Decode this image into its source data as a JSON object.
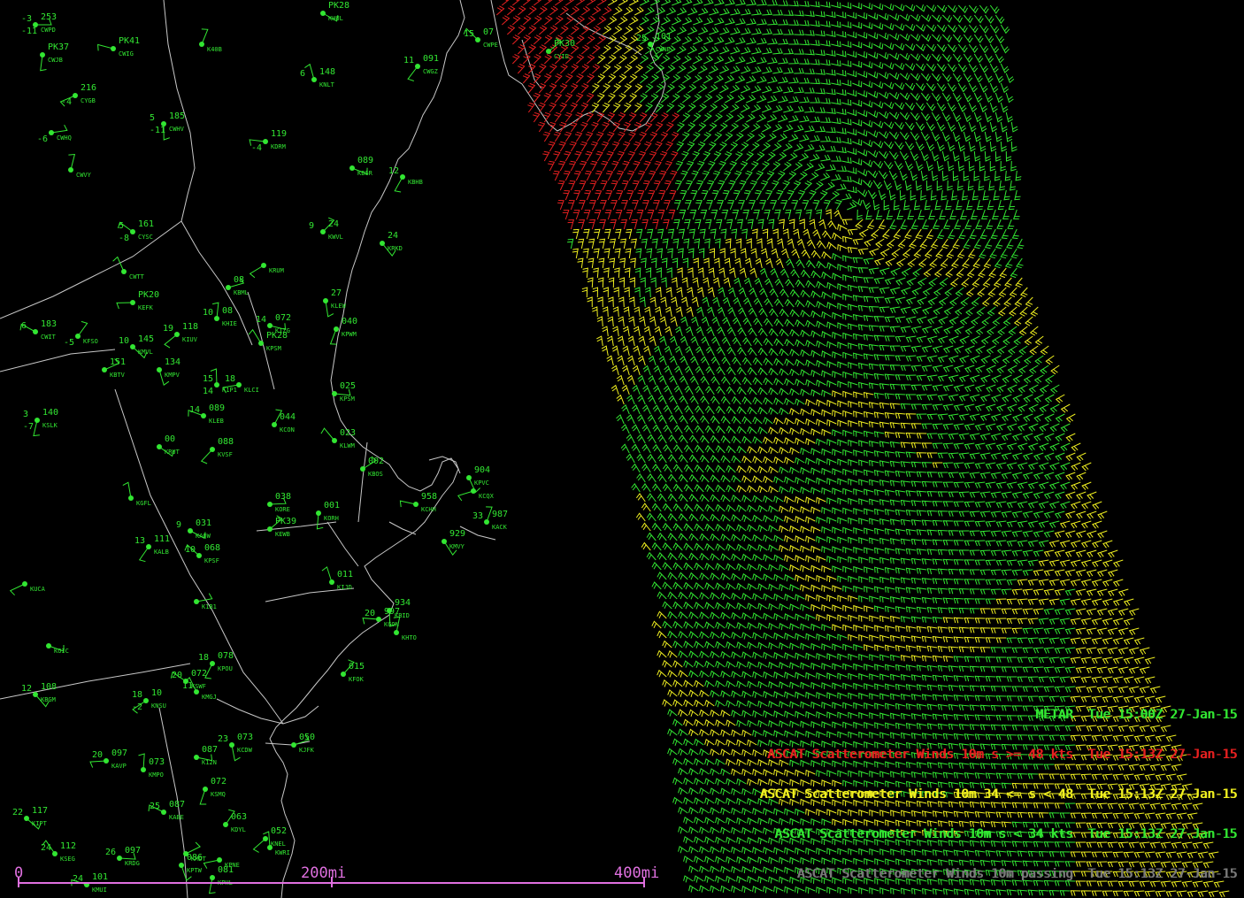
{
  "legend": [
    {
      "text": "METAR  Tue 15:00Z 27-Jan-15",
      "color": "#32e632"
    },
    {
      "text": "ASCAT Scatterometer Winds 10m s >= 48 kts  Tue 15:13Z 27-Jan-15",
      "color": "#e62020"
    },
    {
      "text": "ASCAT Scatterometer Winds 10m 34 <= s < 48  Tue 15:13Z 27-Jan-15",
      "color": "#f0f020"
    },
    {
      "text": "ASCAT Scatterometer Winds 10m s < 34 kts  Tue 15:13Z 27-Jan-15",
      "color": "#32e632"
    },
    {
      "text": "ASCAT Scatterometer Winds 10m passing  Tue 15:13Z 27-Jan-15",
      "color": "#7a7a7a"
    }
  ],
  "scale": {
    "labels": [
      "0",
      "200mi",
      "400mi"
    ],
    "color": "#e070e0"
  },
  "colors": {
    "land_outline": "#c8c8c8",
    "metar": "#32e632",
    "station_marker": "#ffffff",
    "wind_strong": "#e62020",
    "wind_moderate": "#f0f020",
    "wind_light": "#32e632"
  },
  "stations": [
    {
      "id": "CWPD",
      "temp": "-3",
      "dew": "-11",
      "pres": "253"
    },
    {
      "id": "CWJB",
      "temp": "",
      "dew": "",
      "pres": "PK37"
    },
    {
      "id": "CWIG",
      "temp": "",
      "dew": "",
      "pres": "PK41"
    },
    {
      "id": "K40B",
      "temp": "",
      "dew": "",
      "pres": ""
    },
    {
      "id": "KHUL",
      "temp": "",
      "dew": "",
      "pres": "PK28"
    },
    {
      "id": "CWGZ",
      "temp": "11",
      "dew": "",
      "pres": "091"
    },
    {
      "id": "CWPE",
      "temp": "15",
      "dew": "",
      "pres": "07"
    },
    {
      "id": "CYID",
      "temp": "",
      "dew": "",
      "pres": "PK30"
    },
    {
      "id": "CWNE",
      "temp": "25",
      "dew": "",
      "pres": "101"
    },
    {
      "id": "CYGB",
      "temp": "",
      "dew": "-4",
      "pres": "216"
    },
    {
      "id": "KNLT",
      "temp": "6",
      "dew": "",
      "pres": "148"
    },
    {
      "id": "CWHQ",
      "temp": "",
      "dew": "-6",
      "pres": ""
    },
    {
      "id": "CWHV",
      "temp": "5",
      "dew": "-11",
      "pres": "185"
    },
    {
      "id": "KDRM",
      "temp": "",
      "dew": "-4",
      "pres": "119"
    },
    {
      "id": "CWVY",
      "temp": "",
      "dew": "",
      "pres": ""
    },
    {
      "id": "KBGR",
      "temp": "",
      "dew": "",
      "pres": "089"
    },
    {
      "id": "KBHB",
      "temp": "12",
      "dew": "",
      "pres": ""
    },
    {
      "id": "CYSC",
      "temp": "5",
      "dew": "-8",
      "pres": "161"
    },
    {
      "id": "KWVL",
      "temp": "9",
      "dew": "",
      "pres": "24"
    },
    {
      "id": "KRKD",
      "temp": "",
      "dew": "",
      "pres": "24"
    },
    {
      "id": "KRUM",
      "temp": "",
      "dew": "",
      "pres": ""
    },
    {
      "id": "CWTT",
      "temp": "",
      "dew": "",
      "pres": ""
    },
    {
      "id": "KBML",
      "temp": "",
      "dew": "",
      "pres": "08"
    },
    {
      "id": "KLEW",
      "temp": "",
      "dew": "",
      "pres": "27"
    },
    {
      "id": "KEFK",
      "temp": "",
      "dew": "",
      "pres": "PK20"
    },
    {
      "id": "KHIE",
      "temp": "10",
      "dew": "",
      "pres": "08"
    },
    {
      "id": "KIZG",
      "temp": "14",
      "dew": "",
      "pres": "072"
    },
    {
      "id": "KPWM",
      "temp": "",
      "dew": "",
      "pres": "040"
    },
    {
      "id": "CWIT",
      "temp": "6",
      "dew": "",
      "pres": "183"
    },
    {
      "id": "KFSO",
      "temp": "",
      "dew": "-5",
      "pres": ""
    },
    {
      "id": "KMVL",
      "temp": "10",
      "dew": "",
      "pres": "145"
    },
    {
      "id": "KIUV",
      "temp": "19",
      "dew": "",
      "pres": "118"
    },
    {
      "id": "KPSM",
      "temp": "",
      "dew": "",
      "pres": "PK28"
    },
    {
      "id": "KBTV",
      "temp": "",
      "dew": "",
      "pres": "151"
    },
    {
      "id": "KMPV",
      "temp": "",
      "dew": "",
      "pres": "134"
    },
    {
      "id": "KLCI",
      "temp": "18",
      "dew": "",
      "pres": ""
    },
    {
      "id": "K1P1",
      "temp": "15",
      "dew": "14",
      "pres": ""
    },
    {
      "id": "KPSM",
      "temp": "",
      "dew": "",
      "pres": "025"
    },
    {
      "id": "KSLK",
      "temp": "3",
      "dew": "-7",
      "pres": "140"
    },
    {
      "id": "KLEB",
      "temp": "14",
      "dew": "",
      "pres": "089"
    },
    {
      "id": "KCON",
      "temp": "",
      "dew": "",
      "pres": "044"
    },
    {
      "id": "KRUT",
      "temp": "",
      "dew": "",
      "pres": "00"
    },
    {
      "id": "KVSF",
      "temp": "",
      "dew": "",
      "pres": "088"
    },
    {
      "id": "KLWM",
      "temp": "",
      "dew": "",
      "pres": "023"
    },
    {
      "id": "KBOS",
      "temp": "",
      "dew": "",
      "pres": "002"
    },
    {
      "id": "KPVC",
      "temp": "",
      "dew": "",
      "pres": "904"
    },
    {
      "id": "KCQX",
      "temp": "",
      "dew": "",
      "pres": ""
    },
    {
      "id": "KGFL",
      "temp": "",
      "dew": "",
      "pres": ""
    },
    {
      "id": "KORE",
      "temp": "",
      "dew": "",
      "pres": "038"
    },
    {
      "id": "KORH",
      "temp": "",
      "dew": "",
      "pres": "001"
    },
    {
      "id": "KCHH",
      "temp": "",
      "dew": "",
      "pres": "958"
    },
    {
      "id": "KACK",
      "temp": "33",
      "dew": "",
      "pres": "987"
    },
    {
      "id": "KAQW",
      "temp": "9",
      "dew": "",
      "pres": "031"
    },
    {
      "id": "KALB",
      "temp": "13",
      "dew": "",
      "pres": "111"
    },
    {
      "id": "KPSF",
      "temp": "10",
      "dew": "",
      "pres": "068"
    },
    {
      "id": "KEWB",
      "temp": "",
      "dew": "",
      "pres": "PK39"
    },
    {
      "id": "KMVY",
      "temp": "",
      "dew": "",
      "pres": "929"
    },
    {
      "id": "KUCA",
      "temp": "",
      "dew": "",
      "pres": ""
    },
    {
      "id": "KIJD",
      "temp": "",
      "dew": "",
      "pres": "011"
    },
    {
      "id": "K1B1",
      "temp": "",
      "dew": "",
      "pres": ""
    },
    {
      "id": "KBID",
      "temp": "",
      "dew": "",
      "pres": "934"
    },
    {
      "id": "KGON",
      "temp": "20",
      "dew": "",
      "pres": "997"
    },
    {
      "id": "KHTO",
      "temp": "",
      "dew": "",
      "pres": ""
    },
    {
      "id": "KOIC",
      "temp": "",
      "dew": "",
      "pres": ""
    },
    {
      "id": "KPOU",
      "temp": "18",
      "dew": "",
      "pres": "078"
    },
    {
      "id": "KSWF",
      "temp": "20",
      "dew": "",
      "pres": "072"
    },
    {
      "id": "KFOK",
      "temp": "",
      "dew": "",
      "pres": "015"
    },
    {
      "id": "KBGM",
      "temp": "12",
      "dew": "",
      "pres": "108"
    },
    {
      "id": "KNSU",
      "temp": "18",
      "dew": "-2",
      "pres": "10"
    },
    {
      "id": "KMGJ",
      "temp": "11",
      "dew": "",
      "pres": ""
    },
    {
      "id": "KJFK",
      "temp": "",
      "dew": "",
      "pres": "050"
    },
    {
      "id": "KCDW",
      "temp": "23",
      "dew": "",
      "pres": "073"
    },
    {
      "id": "KAVP",
      "temp": "20",
      "dew": "",
      "pres": "097"
    },
    {
      "id": "KMPO",
      "temp": "",
      "dew": "",
      "pres": "073"
    },
    {
      "id": "K12N",
      "temp": "",
      "dew": "",
      "pres": "087"
    },
    {
      "id": "KSMQ",
      "temp": "",
      "dew": "",
      "pres": "072"
    },
    {
      "id": "KABE",
      "temp": "25",
      "dew": "",
      "pres": "087"
    },
    {
      "id": "KDYL",
      "temp": "",
      "dew": "",
      "pres": "063"
    },
    {
      "id": "KIPT",
      "temp": "22",
      "dew": "",
      "pres": "117"
    },
    {
      "id": "KNEL",
      "temp": "",
      "dew": "",
      "pres": "052"
    },
    {
      "id": "KSEG",
      "temp": "24",
      "dew": "",
      "pres": "112"
    },
    {
      "id": "KMDT",
      "temp": "",
      "dew": "",
      "pres": ""
    },
    {
      "id": "KPTW",
      "temp": "",
      "dew": "",
      "pres": "086"
    },
    {
      "id": "KPNE",
      "temp": "",
      "dew": "",
      "pres": ""
    },
    {
      "id": "KWRI",
      "temp": "",
      "dew": "",
      "pres": ""
    },
    {
      "id": "KRDG",
      "temp": "26",
      "dew": "",
      "pres": "097"
    },
    {
      "id": "KPHL",
      "temp": "",
      "dew": "",
      "pres": "081"
    },
    {
      "id": "KMUI",
      "temp": "24",
      "dew": "",
      "pres": "101"
    }
  ]
}
